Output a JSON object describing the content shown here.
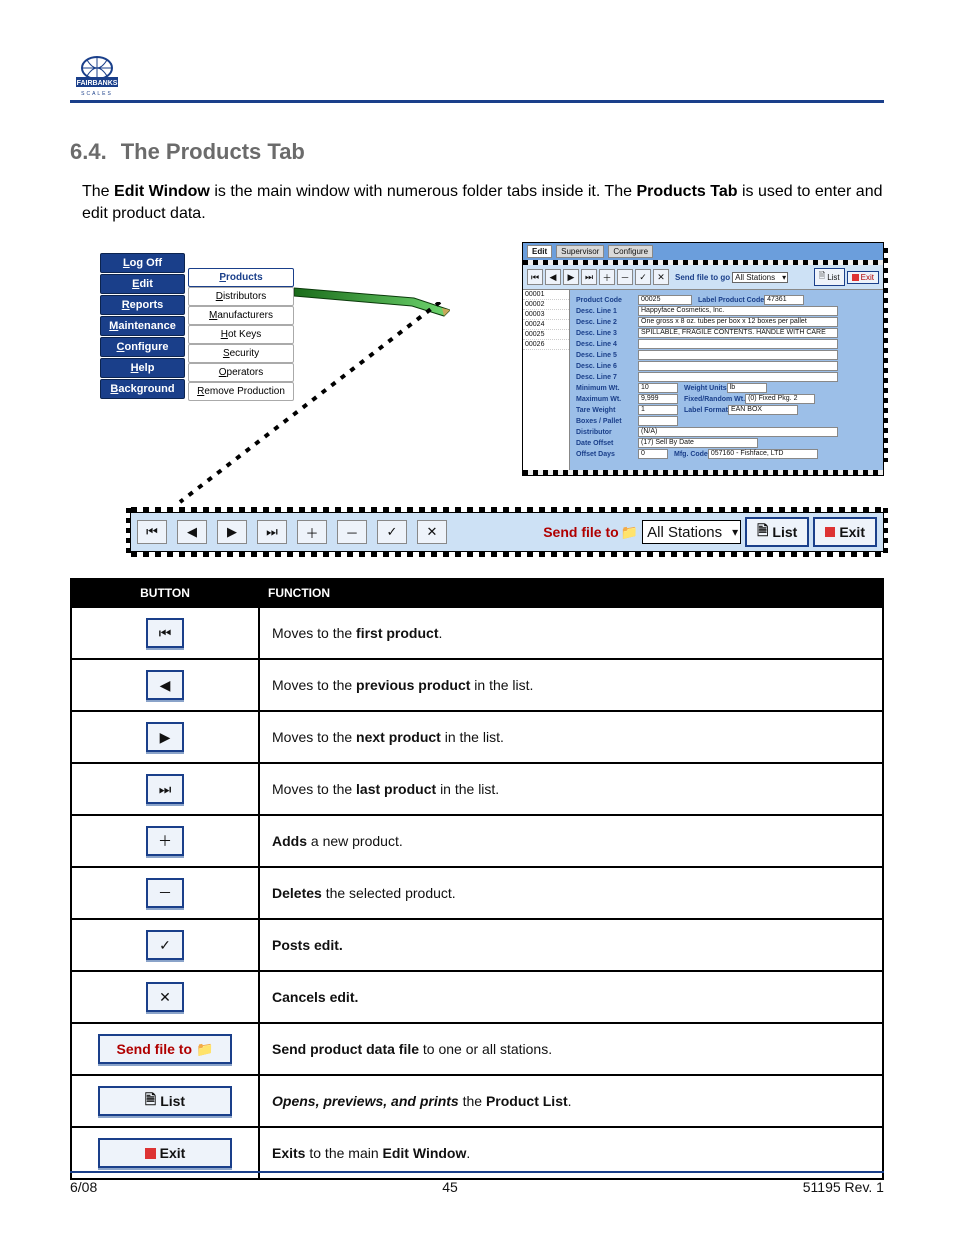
{
  "section": {
    "number": "6.4.",
    "title": "The Products Tab"
  },
  "intro": {
    "t1": "The ",
    "em1": "Edit Window",
    "t2": " is the main window with numerous folder tabs inside it.  The ",
    "em2": "Products Tab",
    "t3": " is used to enter and edit product data."
  },
  "main_menu": [
    "Log Off",
    "Edit",
    "Reports",
    "Maintenance",
    "Configure",
    "Help",
    "Background"
  ],
  "main_menu_ul": [
    "L",
    "E",
    "R",
    "M",
    "C",
    "H",
    "B"
  ],
  "sub_menu": [
    "Products",
    "Distributors",
    "Manufacturers",
    "Hot Keys",
    "Security",
    "Operators",
    "Remove Production"
  ],
  "sub_menu_sel_index": 0,
  "prod_window": {
    "tabs": [
      "Edit",
      "Supervisor",
      "Configure"
    ],
    "nav_icons": [
      "⏮",
      "◀",
      "▶",
      "⏭",
      "＋",
      "－",
      "✓",
      "✕"
    ],
    "send_label": "Send file to go",
    "combo": "All Stations",
    "list_btn": "List",
    "exit_btn": "Exit",
    "product_codes": [
      "00001",
      "00002",
      "00003",
      "00024",
      "00025",
      "00026"
    ],
    "form": {
      "Product Code": "00025",
      "Label Product Code": "47361",
      "Desc. Line 1": "Happyface Cosmetics, Inc.",
      "Desc. Line 2": "One gross x 8 oz. tubes per box x 12 boxes per pallet",
      "Desc. Line 3": "SPILLABLE, FRAGILE CONTENTS.  HANDLE WITH CARE",
      "Desc. Line 4": "",
      "Desc. Line 5": "",
      "Desc. Line 6": "",
      "Desc. Line 7": "",
      "Minimum Wt.": "10",
      "Weight Units": "lb",
      "Maximum Wt.": "9,999",
      "Fixed/Random Wt.": "(0) Fixed Pkg. 2",
      "Tare Weight": "1",
      "Label Format": "EAN BOX",
      "Boxes / Pallet": "",
      "Distributor": "(N/A)",
      "Date Offset": "(17) Sell By Date",
      "Offset Days": "0",
      "Mfg. Code": "057160 - Fishface, LTD"
    }
  },
  "big_toolbar": {
    "nav": [
      "⏮",
      "◀",
      "▶",
      "⏭",
      "＋",
      "－",
      "✓",
      "✕"
    ],
    "send_text": "Send file to",
    "combo": "All Stations",
    "list": "List",
    "exit": "Exit"
  },
  "table": {
    "headers": [
      "BUTTON",
      "FUNCTION"
    ],
    "rows": [
      {
        "icon": "⏮",
        "pre": "Moves to the ",
        "bold": "first product",
        "post": "."
      },
      {
        "icon": "◀",
        "pre": "Moves to the ",
        "bold": "previous product ",
        "post": "in the list."
      },
      {
        "icon": "▶",
        "pre": "Moves to the ",
        "bold": "next product ",
        "post": "in the list."
      },
      {
        "icon": "⏭",
        "pre": "Moves to the ",
        "bold": "last product ",
        "post": "in the list."
      },
      {
        "icon": "＋",
        "bold": "Adds ",
        "post": "a new product."
      },
      {
        "icon": "－",
        "bold": "Deletes ",
        "post": "the selected product."
      },
      {
        "icon": "✓",
        "bold": "Posts edit."
      },
      {
        "icon": "✕",
        "bold": "Cancels edit."
      },
      {
        "wide": "send",
        "label": "Send file to ",
        "icon_after": "📁",
        "bold": "Send product data file ",
        "post": "to one or all stations."
      },
      {
        "wide": "list",
        "label": "List",
        "icon_before": "🗎",
        "bold_i": "Opens, previews, and prints ",
        "post": "the ",
        "bold2": "Product List",
        "post2": "."
      },
      {
        "wide": "exit",
        "label": "Exit",
        "icon_before": "sq",
        "bold": "Exits ",
        "post": "to the main ",
        "bold2": "Edit Window",
        "post2": "."
      }
    ]
  },
  "footer": {
    "left": "6/08",
    "center": "45",
    "right": "51195    Rev. 1"
  }
}
